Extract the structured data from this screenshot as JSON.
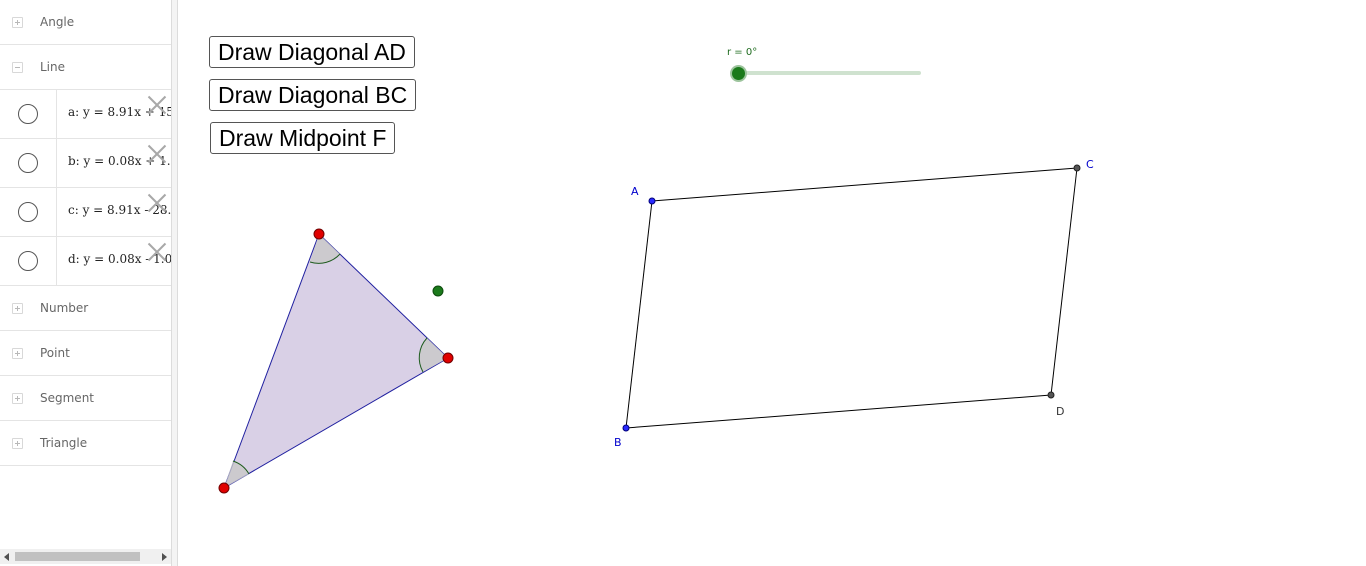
{
  "algebra": {
    "groups": {
      "angle": "Angle",
      "line": "Line",
      "number": "Number",
      "point": "Point",
      "segment": "Segment",
      "triangle": "Triangle"
    },
    "lines": [
      {
        "def": "a: y = 8.91x + 15"
      },
      {
        "def": "b: y = 0.08x + 1."
      },
      {
        "def": "c: y = 8.91x - 28."
      },
      {
        "def": "d: y = 0.08x - 1.0"
      }
    ]
  },
  "buttons": {
    "draw_diagonal_ad": "Draw Diagonal AD",
    "draw_diagonal_bc": "Draw Diagonal BC",
    "draw_midpoint_f": "Draw Midpoint F"
  },
  "slider": {
    "label": "r = 0°",
    "value_deg": 0
  },
  "points": {
    "A": "A",
    "B": "B",
    "C": "C",
    "D": "D"
  },
  "colors": {
    "vertex_red": "#e00000",
    "free_point_green": "#1b7a1b",
    "triangle_fill": "#d9d0e6",
    "triangle_edge": "#2020a0",
    "angle_fill": "#c8c8c8",
    "point_blue": "#0000cc",
    "point_dark": "#444444"
  }
}
